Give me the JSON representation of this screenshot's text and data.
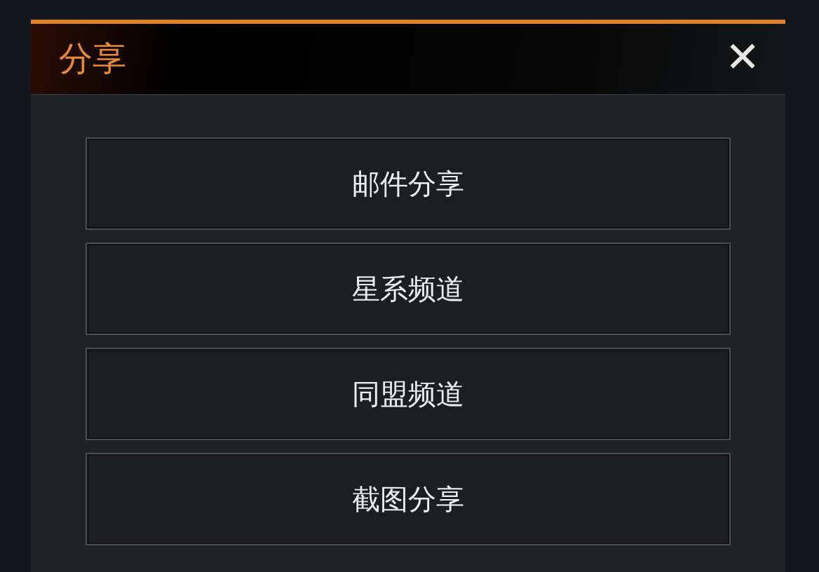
{
  "dialog": {
    "title": "分享",
    "close": "✕"
  },
  "options": [
    {
      "label": "邮件分享"
    },
    {
      "label": "星系频道"
    },
    {
      "label": "同盟频道"
    },
    {
      "label": "截图分享"
    }
  ]
}
